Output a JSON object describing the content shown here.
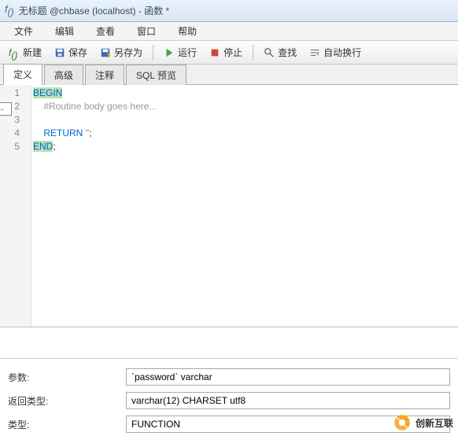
{
  "window": {
    "title": "无标题 @chbase (localhost) - 函数 *"
  },
  "menu": {
    "items": [
      "文件",
      "编辑",
      "查看",
      "窗口",
      "帮助"
    ]
  },
  "toolbar": {
    "new": "新建",
    "save": "保存",
    "saveAs": "另存为",
    "run": "运行",
    "stop": "停止",
    "find": "查找",
    "wrap": "自动换行"
  },
  "tabs": {
    "items": [
      "定义",
      "高级",
      "注释",
      "SQL 预览"
    ],
    "active": 0
  },
  "code": {
    "lines": [
      {
        "n": "1",
        "segs": [
          {
            "t": "BEGIN",
            "c": "kw"
          }
        ]
      },
      {
        "n": "2",
        "segs": [
          {
            "t": "    #Routine body goes here...",
            "c": "cm"
          }
        ]
      },
      {
        "n": "3",
        "segs": [
          {
            "t": "",
            "c": "tx"
          }
        ]
      },
      {
        "n": "4",
        "segs": [
          {
            "t": "    ",
            "c": "tx"
          },
          {
            "t": "RETURN",
            "c": "tx",
            "color": "#0066cc"
          },
          {
            "t": " ",
            "c": "tx"
          },
          {
            "t": "''",
            "c": "st"
          },
          {
            "t": ";",
            "c": "tx"
          }
        ]
      },
      {
        "n": "5",
        "segs": [
          {
            "t": "END",
            "c": "kw"
          },
          {
            "t": ";",
            "c": "tx"
          }
        ]
      }
    ]
  },
  "props": {
    "paramsLabel": "参数:",
    "paramsValue": "`password` varchar",
    "returnLabel": "返回类型:",
    "returnValue": "varchar(12) CHARSET utf8",
    "typeLabel": "类型:",
    "typeValue": "FUNCTION"
  },
  "watermark": "创新互联"
}
